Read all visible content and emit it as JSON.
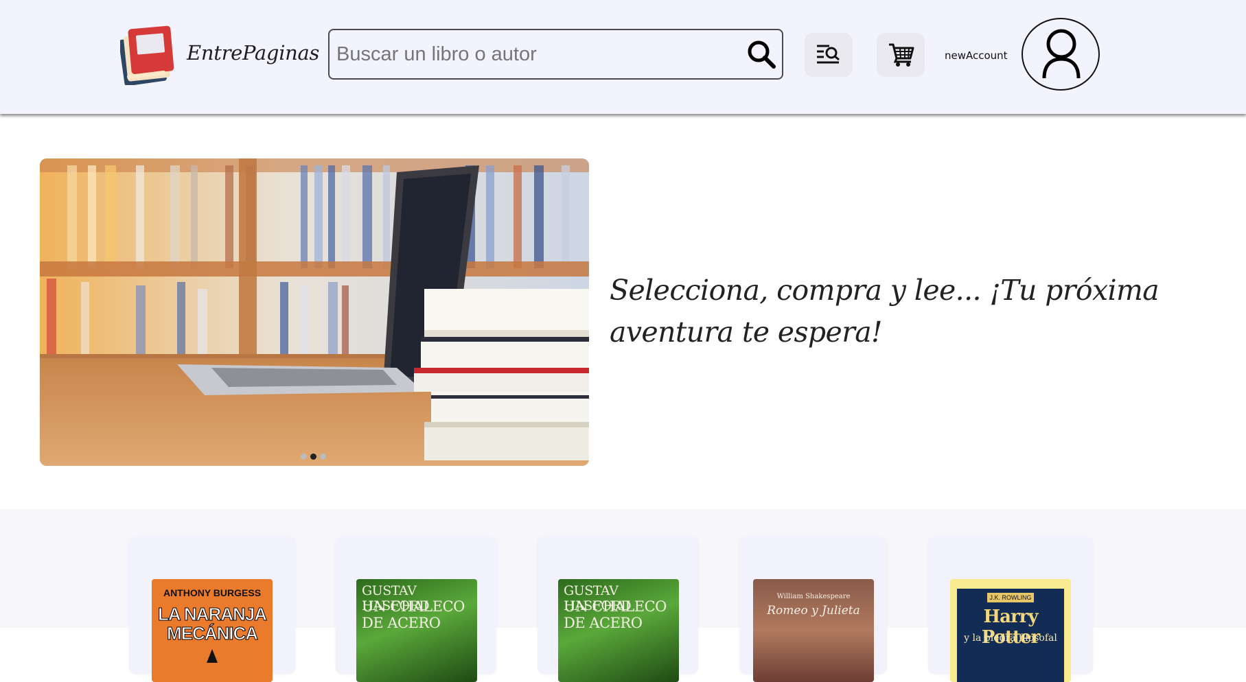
{
  "header": {
    "logo_text": "EntrePaginas",
    "search": {
      "placeholder": "Buscar un libro o autor",
      "value": ""
    },
    "account_label": "newAccount"
  },
  "hero": {
    "tagline": "Selecciona, compra y lee... ¡Tu próxima aventura te espera!",
    "carousel": {
      "slides": 3,
      "active_index": 1
    }
  },
  "books": [
    {
      "cover_lines": [
        "ANTHONY BURGESS",
        "LA NARANJA",
        "MECÁNICA"
      ]
    },
    {
      "cover_lines": [
        "GUSTAV HASFORD",
        "UN CHALECO",
        "DE ACERO"
      ]
    },
    {
      "cover_lines": [
        "GUSTAV HASFORD",
        "UN CHALECO",
        "DE ACERO"
      ]
    },
    {
      "cover_lines": [
        "William Shakespeare",
        "Romeo y Julieta"
      ]
    },
    {
      "cover_lines": [
        "J.K. ROWLING",
        "Harry Potter",
        "y la piedra filosofal"
      ]
    }
  ],
  "colors": {
    "header_bg": "#f2f3fd",
    "catalog_bg": "#f7f7fb",
    "logo_red": "#d63a38",
    "logo_navy": "#2f4564"
  },
  "icons": [
    "logo-books-icon",
    "search-icon",
    "filter-search-icon",
    "cart-icon",
    "user-icon"
  ]
}
